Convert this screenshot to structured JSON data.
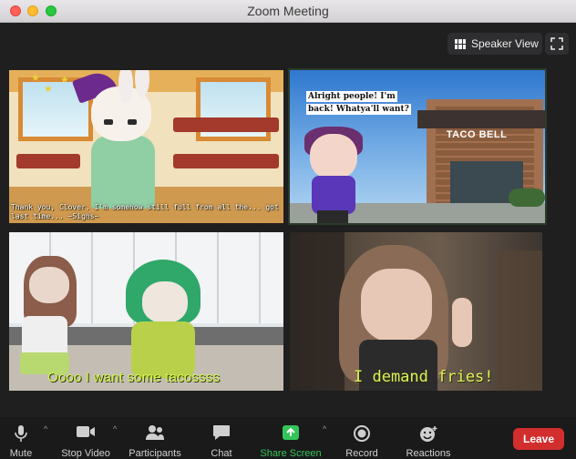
{
  "window": {
    "title": "Zoom Meeting"
  },
  "view_controls": {
    "speaker_view_label": "Speaker View",
    "fullscreen_icon": "fullscreen-icon"
  },
  "video_tiles": [
    {
      "caption": "Thank you, Clover. I'm somehow still full from all the... got  last time... ~Sighs~"
    },
    {
      "bubble_line1": "Alright people! I'm",
      "bubble_line2": "back! Whatya'll want?",
      "sign": "TACO BELL"
    },
    {
      "caption": "Oooo I want some tacossss"
    },
    {
      "caption": "I demand fries!"
    }
  ],
  "toolbar": {
    "mute_label": "Mute",
    "stop_video_label": "Stop Video",
    "participants_label": "Participants",
    "chat_label": "Chat",
    "share_screen_label": "Share Screen",
    "record_label": "Record",
    "reactions_label": "Reactions",
    "leave_label": "Leave",
    "accent_share": "#33c45a",
    "leave_color": "#d22e2e"
  }
}
